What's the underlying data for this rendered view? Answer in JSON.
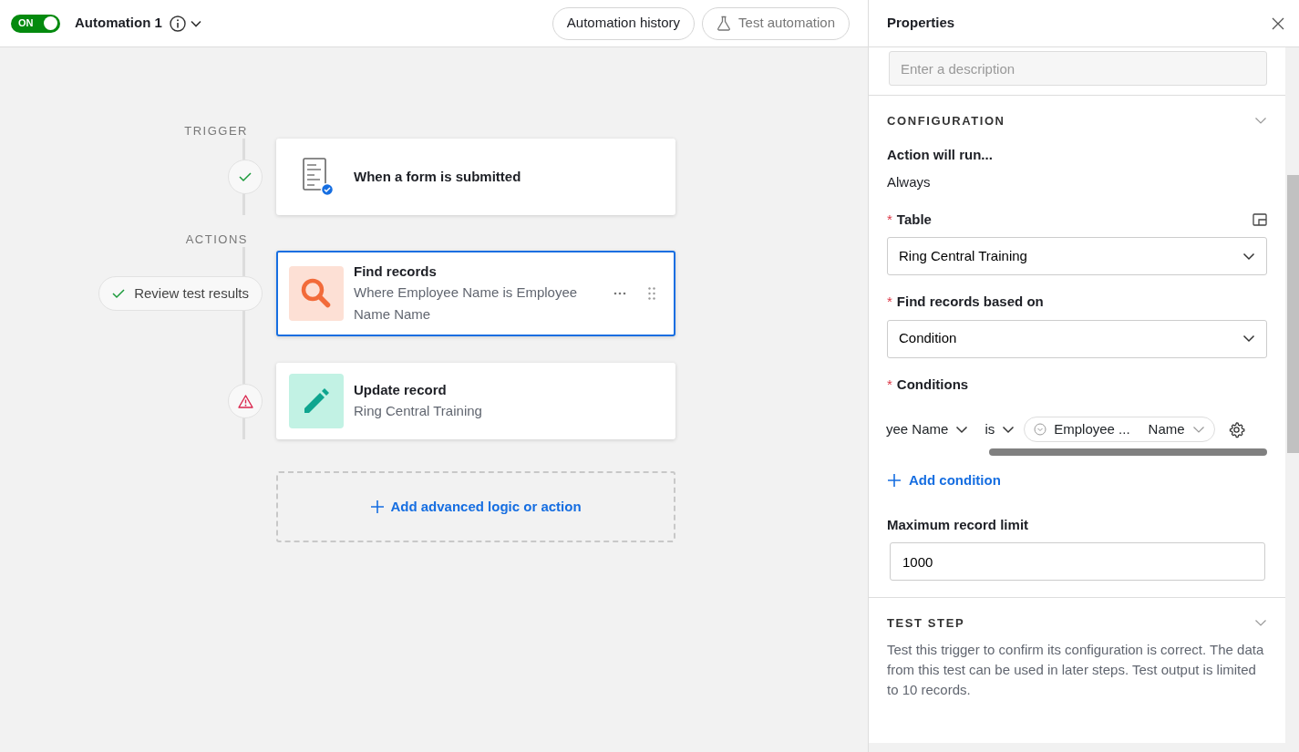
{
  "toolbar": {
    "toggle": {
      "label": "ON",
      "on": true
    },
    "title": "Automation 1",
    "buttons": [
      {
        "label": "Automation history",
        "kind": "plain"
      },
      {
        "label": "Test automation",
        "kind": "flask"
      }
    ]
  },
  "flow": {
    "sections": [
      {
        "label": "TRIGGER",
        "steps": [
          {
            "title": "When a form is submitted",
            "kind": "form",
            "selected": false,
            "warning": false
          }
        ]
      },
      {
        "label": "ACTIONS",
        "steps": [
          {
            "title": "Find records",
            "subtitle": "Where Employee Name is Employee Name Name",
            "kind": "find",
            "selected": true,
            "warning": false,
            "status_label": "Review test results"
          },
          {
            "title": "Update record",
            "subtitle": "Ring Central Training",
            "kind": "update",
            "selected": false,
            "warning": true
          }
        ]
      }
    ],
    "add_label": "Add advanced logic or action"
  },
  "panel": {
    "title": "Properties",
    "description_placeholder": "Enter a description",
    "config": {
      "heading": "CONFIGURATION",
      "run_label": "Action will run...",
      "run_value": "Always",
      "fields": [
        {
          "label": "Table",
          "required_mark": "*",
          "value": "Ring Central Training"
        },
        {
          "label": "Find records based on",
          "required_mark": "*",
          "value": "Condition"
        }
      ],
      "conditions": {
        "label": "Conditions",
        "required_mark": "*",
        "field": "yee Name",
        "operator": "is",
        "value": "Employee ...",
        "value_field": "Name"
      },
      "add_condition": "Add condition",
      "limit": {
        "label": "Maximum record limit",
        "value": "1000"
      }
    },
    "test_step": {
      "heading": "TEST STEP",
      "text": "Test this trigger to confirm its configuration is correct. The data from this test can be used in later steps. Test output is limited to 10 records."
    }
  }
}
